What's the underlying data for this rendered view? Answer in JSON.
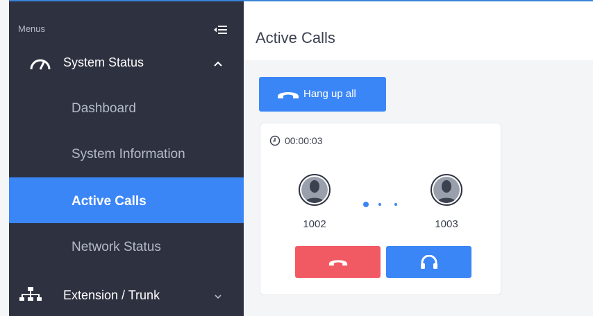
{
  "sidebar": {
    "menus_label": "Menus",
    "items": [
      {
        "label": "System Status",
        "expanded": true
      },
      {
        "label": "Dashboard"
      },
      {
        "label": "System Information"
      },
      {
        "label": "Active Calls",
        "active": true
      },
      {
        "label": "Network Status"
      },
      {
        "label": "Extension / Trunk",
        "expanded": false
      }
    ]
  },
  "main": {
    "title": "Active Calls",
    "hangup_all_label": "Hang up all",
    "call": {
      "duration": "00:00:03",
      "caller": "1002",
      "callee": "1003"
    }
  },
  "colors": {
    "sidebar_bg": "#2e3240",
    "accent": "#3b86f7",
    "danger": "#f25a63"
  },
  "icons": [
    "menu-collapse-icon",
    "gauge-icon",
    "chevron-up-icon",
    "extension-trunk-icon",
    "chevron-down-icon",
    "phone-hangup-icon",
    "clock-icon",
    "user-avatar-icon",
    "headset-icon"
  ]
}
